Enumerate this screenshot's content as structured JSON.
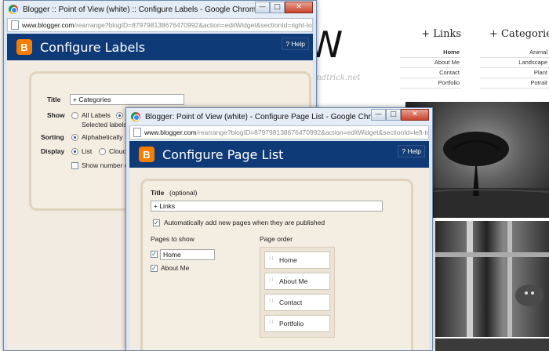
{
  "blog_background": {
    "title_fragment": "W",
    "links": {
      "heading": "+ Links",
      "items": [
        "Home",
        "About Me",
        "Contact",
        "Portfolio"
      ]
    },
    "categories": {
      "heading": "+ Categories",
      "items": [
        "Animal",
        "Landscape",
        "Plant",
        "Potrait"
      ]
    },
    "watermark": "http://www.bloggertipandtrick.net"
  },
  "labels_window": {
    "title": "Blogger :: Point of View (white) :: Configure Labels - Google Chrome",
    "url_host": "www.blogger.com",
    "url_path": "/rearrange?blogID=879798138676470992&action=editWidget&sectionId=right-top-",
    "header_title": "Configure Labels",
    "help": "? Help",
    "form": {
      "title_label": "Title",
      "title_value": "+ Categories",
      "show_label": "Show",
      "show_all_labels": "All Labels",
      "show_selected": "Selected labels",
      "sorting_label": "Sorting",
      "sorting_value": "Alphabetically",
      "display_label": "Display",
      "display_list": "List",
      "display_cloud": "Cloud",
      "show_number": "Show number o"
    }
  },
  "pagelist_window": {
    "title": "Blogger: Point of View (white) - Configure Page List - Google Chrome",
    "url_host": "www.blogger.com",
    "url_path": "/rearrange?blogID=879798138676470992&action=editWidget&sectionId=left-top&",
    "header_title": "Configure Page List",
    "help": "? Help",
    "form": {
      "title_label": "Title",
      "title_optional": "(optional)",
      "title_value": "+ Links",
      "auto_add_label": "Automatically add new pages when they are published",
      "pages_to_show_label": "Pages to show",
      "pages": [
        "Home",
        "About Me"
      ],
      "page_order_label": "Page order",
      "order": [
        "Home",
        "About Me",
        "Contact",
        "Portfolio"
      ]
    }
  },
  "window_buttons": {
    "minimize": "—",
    "maximize": "□",
    "close": "✕"
  },
  "colors": {
    "header_blue": "#0f3a78",
    "blogger_orange": "#f57d00",
    "panel_bg": "#f2ebe1"
  }
}
